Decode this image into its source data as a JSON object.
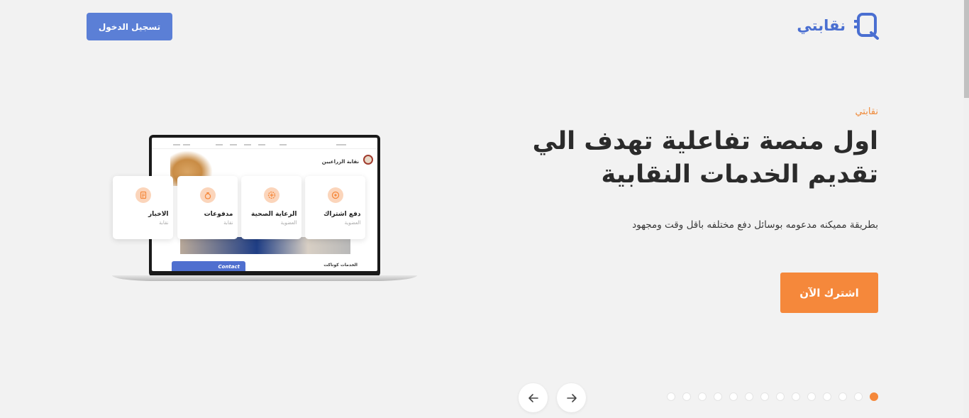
{
  "header": {
    "logo_text": "نقابتي",
    "logo_icon": "logo-mark-icon",
    "login_label": "تسجيل الدخول"
  },
  "hero": {
    "eyebrow": "نقابتي",
    "title_line1": "اول منصة تفاعلية تهدف الي",
    "title_line2": "تقديم الخدمات النقابية",
    "subtitle": "بطريقة مميكنه مدعومه بوسائل دفع مختلفه باقل وقت ومجهود",
    "cta_label": "اشترك الآن"
  },
  "laptop": {
    "site_title": "نقابة الزراعيين",
    "section_title": "الخدمات كوناكت",
    "contact_label": "Contact"
  },
  "cards": [
    {
      "title": "دفع اشتراك",
      "sub": "العضوية",
      "icon": "coin-icon"
    },
    {
      "title": "الرعاية الصحية",
      "sub": "العضوية",
      "icon": "health-icon"
    },
    {
      "title": "مدفوعات",
      "sub": "نقابة",
      "icon": "money-bag-icon"
    },
    {
      "title": "الاخبار",
      "sub": "نقابة",
      "icon": "document-icon"
    }
  ],
  "slider": {
    "prev_icon": "arrow-left-icon",
    "next_icon": "arrow-right-icon",
    "dot_count": 14,
    "active_index": 0
  },
  "colors": {
    "accent": "#f5883b",
    "brand": "#5b7fd6",
    "logo": "#4a6fd1",
    "background": "#f2f2f2"
  }
}
